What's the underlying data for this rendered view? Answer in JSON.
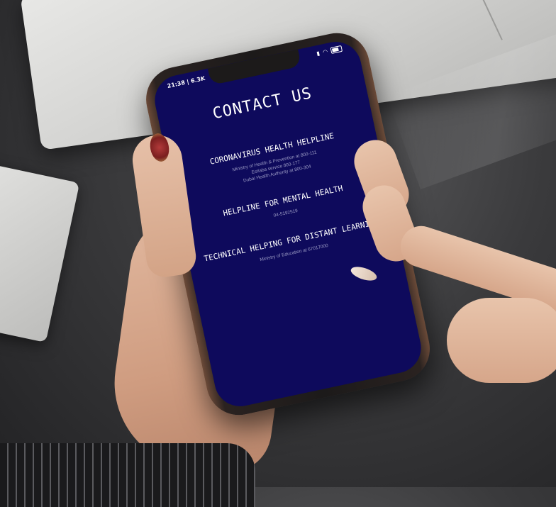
{
  "status_bar": {
    "time": "21:38 | 6.3K",
    "battery_label": ""
  },
  "page": {
    "title": "CONTACT US"
  },
  "sections": [
    {
      "title": "CORONAVIRUS HEALTH HELPLINE",
      "lines": [
        "Ministry of Health & Prevention at 800-111",
        "Estiaba service 800-177",
        "Dubai Health Authority at 800-304"
      ]
    },
    {
      "title": "HELPLINE FOR MENTAL HEALTH",
      "lines": [
        "04-5192519"
      ]
    },
    {
      "title": "TECHNICAL HELPING FOR DISTANT LEARNING",
      "lines": [
        "Ministry of Education at 67017000"
      ]
    }
  ],
  "icons": [
    "signal-icon",
    "wifi-icon",
    "battery-icon"
  ]
}
